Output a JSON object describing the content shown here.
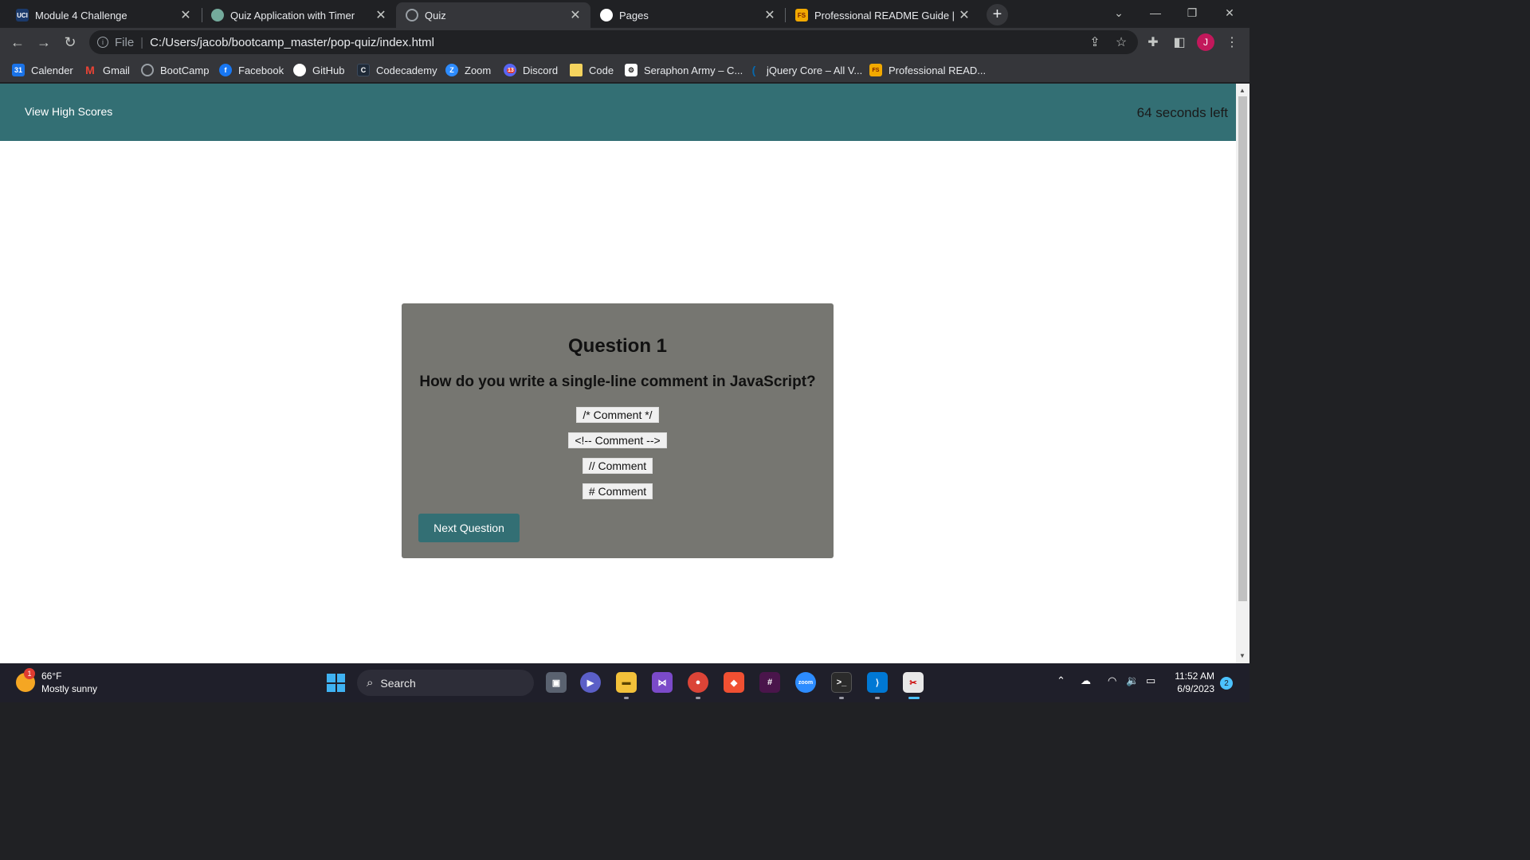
{
  "browser": {
    "tabs": [
      {
        "title": "Module 4 Challenge",
        "favicon": "uci-icon",
        "favicon_text": "UCI",
        "active": false
      },
      {
        "title": "Quiz Application with Timer",
        "favicon": "chatgpt-icon",
        "active": false
      },
      {
        "title": "Quiz",
        "favicon": "globe-icon",
        "active": true
      },
      {
        "title": "Pages",
        "favicon": "github-icon",
        "active": false
      },
      {
        "title": "Professional README Guide | The",
        "favicon": "fs-icon",
        "favicon_text": "FS",
        "active": false
      }
    ],
    "address": {
      "scheme": "File",
      "url": "C:/Users/jacob/bootcamp_master/pop-quiz/index.html"
    },
    "profile_initial": "J",
    "bookmarks": [
      {
        "label": "Calender",
        "icon": "calendar-icon"
      },
      {
        "label": "Gmail",
        "icon": "gmail-icon"
      },
      {
        "label": "BootCamp",
        "icon": "globe-icon"
      },
      {
        "label": "Facebook",
        "icon": "facebook-icon"
      },
      {
        "label": "GitHub",
        "icon": "github-icon"
      },
      {
        "label": "Codecademy",
        "icon": "codecademy-icon"
      },
      {
        "label": "Zoom",
        "icon": "zoom-icon"
      },
      {
        "label": "Discord",
        "icon": "discord-icon",
        "badge": "13"
      },
      {
        "label": "Code",
        "icon": "folder-icon"
      },
      {
        "label": "Seraphon Army – C...",
        "icon": "seraphon-icon"
      },
      {
        "label": "jQuery Core – All V...",
        "icon": "jquery-icon"
      },
      {
        "label": "Professional READ...",
        "icon": "fs-icon"
      }
    ]
  },
  "page": {
    "header": {
      "view_high_scores": "View High Scores",
      "timer_text": "64 seconds left"
    },
    "quiz": {
      "question_title": "Question 1",
      "question_text": "How do you write a single-line comment in JavaScript?",
      "answers": [
        "/* Comment */",
        "<!-- Comment -->",
        "// Comment",
        "# Comment"
      ],
      "next_button": "Next Question"
    },
    "colors": {
      "header_bg": "#336f74",
      "card_bg": "#767671",
      "button_bg": "#336f74"
    }
  },
  "taskbar": {
    "weather": {
      "temp": "66°F",
      "condition": "Mostly sunny",
      "badge": "1"
    },
    "search_placeholder": "Search",
    "clock": {
      "time": "11:52 AM",
      "date": "6/9/2023"
    },
    "notification_count": "2"
  }
}
